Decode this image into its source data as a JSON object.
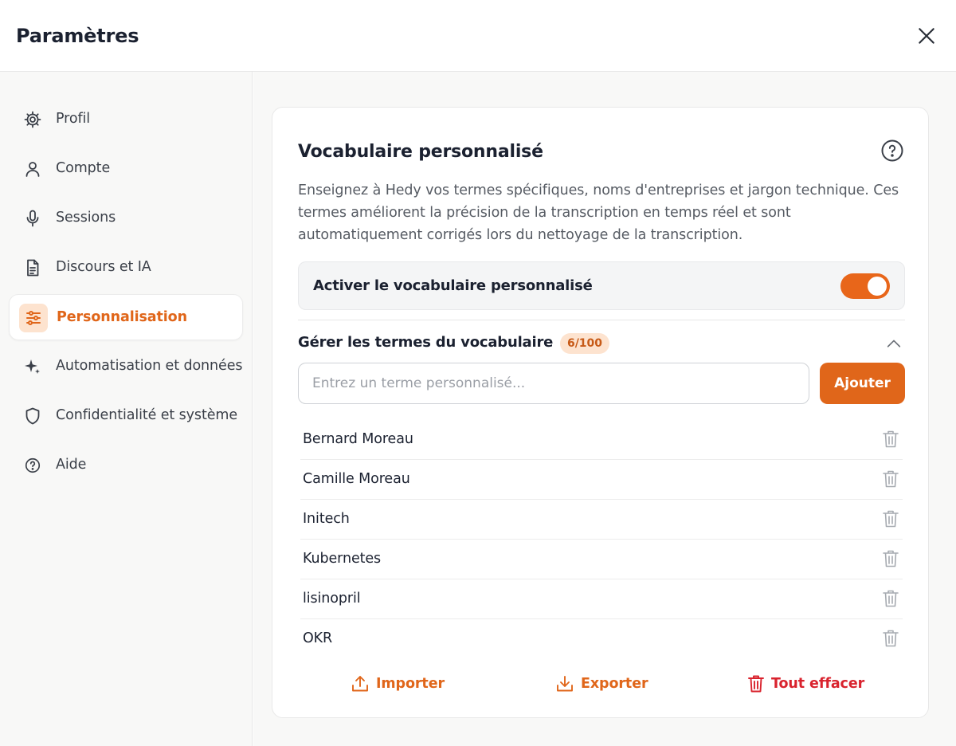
{
  "header": {
    "title": "Paramètres"
  },
  "sidebar": {
    "items": [
      {
        "label": "Profil",
        "icon": "gear-icon"
      },
      {
        "label": "Compte",
        "icon": "user-icon"
      },
      {
        "label": "Sessions",
        "icon": "microphone-icon"
      },
      {
        "label": "Discours et IA",
        "icon": "document-icon"
      },
      {
        "label": "Personnalisation",
        "icon": "sliders-icon",
        "active": true
      },
      {
        "label": "Automatisation et données",
        "icon": "sparkle-icon"
      },
      {
        "label": "Confidentialité et système",
        "icon": "shield-icon"
      },
      {
        "label": "Aide",
        "icon": "help-circle-icon"
      }
    ]
  },
  "main": {
    "title": "Vocabulaire personnalisé",
    "description": "Enseignez à Hedy vos termes spécifiques, noms d'entreprises et jargon technique. Ces termes améliorent la précision de la transcription en temps réel et sont automatiquement corrigés lors du nettoyage de la transcription.",
    "toggle": {
      "label": "Activer le vocabulaire personnalisé",
      "enabled": true
    },
    "manage": {
      "title": "Gérer les termes du vocabulaire",
      "count": "6/100",
      "input_placeholder": "Entrez un terme personnalisé...",
      "add_label": "Ajouter"
    },
    "terms": [
      "Bernard Moreau",
      "Camille Moreau",
      "Initech",
      "Kubernetes",
      "lisinopril",
      "OKR"
    ],
    "actions": {
      "import_label": "Importer",
      "export_label": "Exporter",
      "clear_label": "Tout effacer"
    }
  },
  "colors": {
    "accent": "#e0661a",
    "accent_soft": "#fde3cf",
    "danger": "#d9232e",
    "text": "#1b2130",
    "muted": "#565b63"
  }
}
